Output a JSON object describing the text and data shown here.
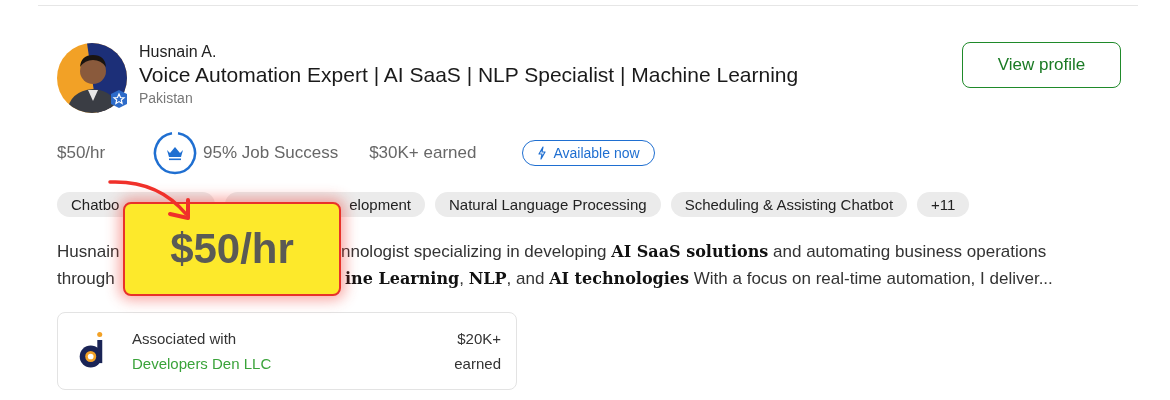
{
  "freelancer": {
    "name": "Husnain A.",
    "title": "Voice Automation Expert | AI SaaS | NLP Specialist | Machine Learning",
    "location": "Pakistan",
    "view_button": "View profile"
  },
  "stats": {
    "rate": "$50/hr",
    "job_success": {
      "text": "95% Job Success"
    },
    "earned": "$30K+ earned",
    "availability": "Available now"
  },
  "skills": [
    {
      "label": "Chatbo",
      "kind": "cut-right"
    },
    {
      "label": "elopment",
      "kind": "cut-left"
    },
    {
      "label": "Natural Language Processing",
      "kind": "full"
    },
    {
      "label": "Scheduling & Assisting Chatbot",
      "kind": "full"
    },
    {
      "label": "+11",
      "kind": "full"
    }
  ],
  "description": [
    {
      "left": "Husnain",
      "right": "nnologist specializing in developing **AI SaaS solutions** and automating business operations"
    },
    {
      "left": "through",
      "right": "**ine Learning**, **NLP**, and **AI technologies** With a focus on real-time automation, I deliver..."
    }
  ],
  "association": {
    "label": "Associated with",
    "agency": "Developers Den LLC",
    "amount": "$20K+",
    "amount_label": "earned"
  },
  "callout": {
    "text": "$50/hr"
  }
}
